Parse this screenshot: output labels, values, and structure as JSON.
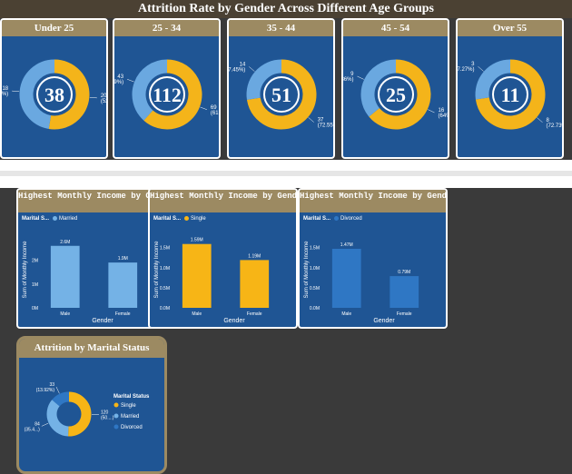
{
  "header": {
    "title": "Attrition Rate by Gender Across Different Age Groups"
  },
  "colors": {
    "female": "#6aa8e0",
    "male": "#f4b41a",
    "married": "#74b2e6",
    "single": "#f7b516",
    "divorced": "#2f77c4"
  },
  "chart_data": [
    {
      "type": "donut",
      "title": "Under 25",
      "total": "38",
      "slices": [
        {
          "value": 20,
          "label": "20",
          "pct": "(52.63%)",
          "color": "#f4b41a"
        },
        {
          "value": 18,
          "label": "18",
          "pct": "(47.37%)",
          "color": "#6aa8e0"
        }
      ]
    },
    {
      "type": "donut",
      "title": "25 - 34",
      "total": "112",
      "slices": [
        {
          "value": 69,
          "label": "69",
          "pct": "(61.61%)",
          "color": "#f4b41a"
        },
        {
          "value": 43,
          "label": "43",
          "pct": "(38.39%)",
          "color": "#6aa8e0"
        }
      ]
    },
    {
      "type": "donut",
      "title": "35 - 44",
      "total": "51",
      "slices": [
        {
          "value": 37,
          "label": "37",
          "pct": "(72.55%)",
          "color": "#f4b41a"
        },
        {
          "value": 14,
          "label": "14",
          "pct": "(27.45%)",
          "color": "#6aa8e0"
        }
      ]
    },
    {
      "type": "donut",
      "title": "45 - 54",
      "total": "25",
      "slices": [
        {
          "value": 16,
          "label": "16",
          "pct": "(64%)",
          "color": "#f4b41a"
        },
        {
          "value": 9,
          "label": "9",
          "pct": "(36%)",
          "color": "#6aa8e0"
        }
      ]
    },
    {
      "type": "donut",
      "title": "Over 55",
      "total": "11",
      "slices": [
        {
          "value": 8,
          "label": "8",
          "pct": "(72.73%)",
          "color": "#f4b41a"
        },
        {
          "value": 3,
          "label": "3",
          "pct": "(27.27%)",
          "color": "#6aa8e0"
        }
      ]
    },
    {
      "type": "bar",
      "title": "Highest Monthly Income by Gender and Marital Status",
      "legend_title": "Marital S...",
      "legend_item": "Married",
      "color": "#74b2e6",
      "categories": [
        "Male",
        "Female"
      ],
      "values": [
        2.6,
        1.9
      ],
      "value_labels": [
        "2.6M",
        "1.9M"
      ],
      "xlabel": "Gender",
      "ylabel": "Sum of Monthly Income",
      "ticks": [
        0,
        1,
        2
      ],
      "tick_labels": [
        "0M",
        "1M",
        "2M"
      ],
      "ylim": [
        0,
        3.2
      ]
    },
    {
      "type": "bar",
      "title": "Highest Monthly Income by Gender and Marital Status",
      "legend_title": "Marital S...",
      "legend_item": "Single",
      "color": "#f7b516",
      "categories": [
        "Male",
        "Female"
      ],
      "values": [
        1.59,
        1.19
      ],
      "value_labels": [
        "1.59M",
        "1.19M"
      ],
      "xlabel": "Gender",
      "ylabel": "Sum of Monthly Income",
      "ticks": [
        0,
        0.5,
        1.0,
        1.5
      ],
      "tick_labels": [
        "0.0M",
        "0.5M",
        "1.0M",
        "1.5M"
      ],
      "ylim": [
        0,
        1.9
      ]
    },
    {
      "type": "bar",
      "title": "Highest Monthly Income by Gender and Marital Status",
      "legend_title": "Marital S...",
      "legend_item": "Divorced",
      "color": "#2f77c4",
      "categories": [
        "Male",
        "Female"
      ],
      "values": [
        1.47,
        0.79
      ],
      "value_labels": [
        "1.47M",
        "0.79M"
      ],
      "xlabel": "Gender",
      "ylabel": "Sum of Monthly Income",
      "ticks": [
        0,
        0.5,
        1.0,
        1.5
      ],
      "tick_labels": [
        "0.0M",
        "0.5M",
        "1.0M",
        "1.5M"
      ],
      "ylim": [
        0,
        1.9
      ]
    },
    {
      "type": "donut",
      "title": "Attrition by Marital Status",
      "legend_title": "Marital Status",
      "slices": [
        {
          "value": 120,
          "label": "120",
          "pct": "(50....)",
          "name": "Single",
          "color": "#f7b516"
        },
        {
          "value": 84,
          "label": "84",
          "pct": "(35.4...)",
          "name": "Married",
          "color": "#74b2e6"
        },
        {
          "value": 33,
          "label": "33",
          "pct": "(13.92%)",
          "name": "Divorced",
          "color": "#2f77c4"
        }
      ]
    }
  ]
}
